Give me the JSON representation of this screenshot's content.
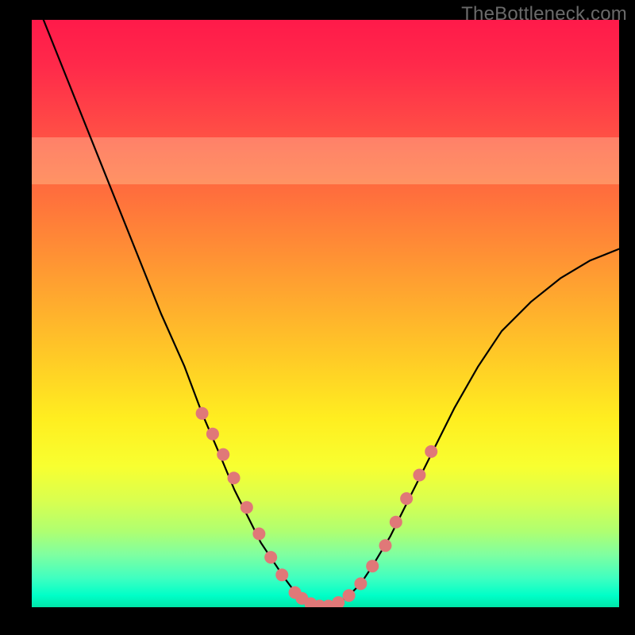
{
  "watermark": "TheBottleneck.com",
  "chart_data": {
    "type": "line",
    "title": "",
    "xlabel": "",
    "ylabel": "",
    "xlim": [
      0,
      100
    ],
    "ylim": [
      0,
      100
    ],
    "grid": false,
    "legend": false,
    "bands": [
      {
        "y0": 72,
        "y1": 80,
        "color": "pale-yellow"
      }
    ],
    "series": [
      {
        "name": "bottleneck-curve",
        "color": "#000000",
        "x": [
          2,
          6,
          10,
          14,
          18,
          22,
          26,
          29,
          32,
          34.5,
          37,
          39,
          41,
          43,
          44.5,
          46,
          47.5,
          49,
          50.5,
          52,
          54,
          56,
          58,
          61,
          64,
          68,
          72,
          76,
          80,
          85,
          90,
          95,
          100
        ],
        "y": [
          100,
          90,
          80,
          70,
          60,
          50,
          41,
          33,
          26,
          20,
          15,
          11,
          8,
          5,
          3,
          1.5,
          0.6,
          0.2,
          0.2,
          0.6,
          2,
          4,
          7,
          12,
          18,
          26,
          34,
          41,
          47,
          52,
          56,
          59,
          61
        ]
      }
    ],
    "markers": {
      "name": "curve-dots",
      "color": "#e07878",
      "radius_px": 8,
      "x": [
        29,
        30.8,
        32.6,
        34.4,
        36.6,
        38.7,
        40.7,
        42.6,
        44.8,
        46,
        47.5,
        49,
        50.5,
        52.2,
        54,
        56,
        58,
        60.2,
        62,
        63.8,
        66,
        68
      ],
      "y": [
        33,
        29.5,
        26,
        22,
        17,
        12.5,
        8.5,
        5.5,
        2.5,
        1.5,
        0.6,
        0.2,
        0.2,
        0.8,
        2,
        4,
        7,
        10.5,
        14.5,
        18.5,
        22.5,
        26.5
      ]
    }
  }
}
